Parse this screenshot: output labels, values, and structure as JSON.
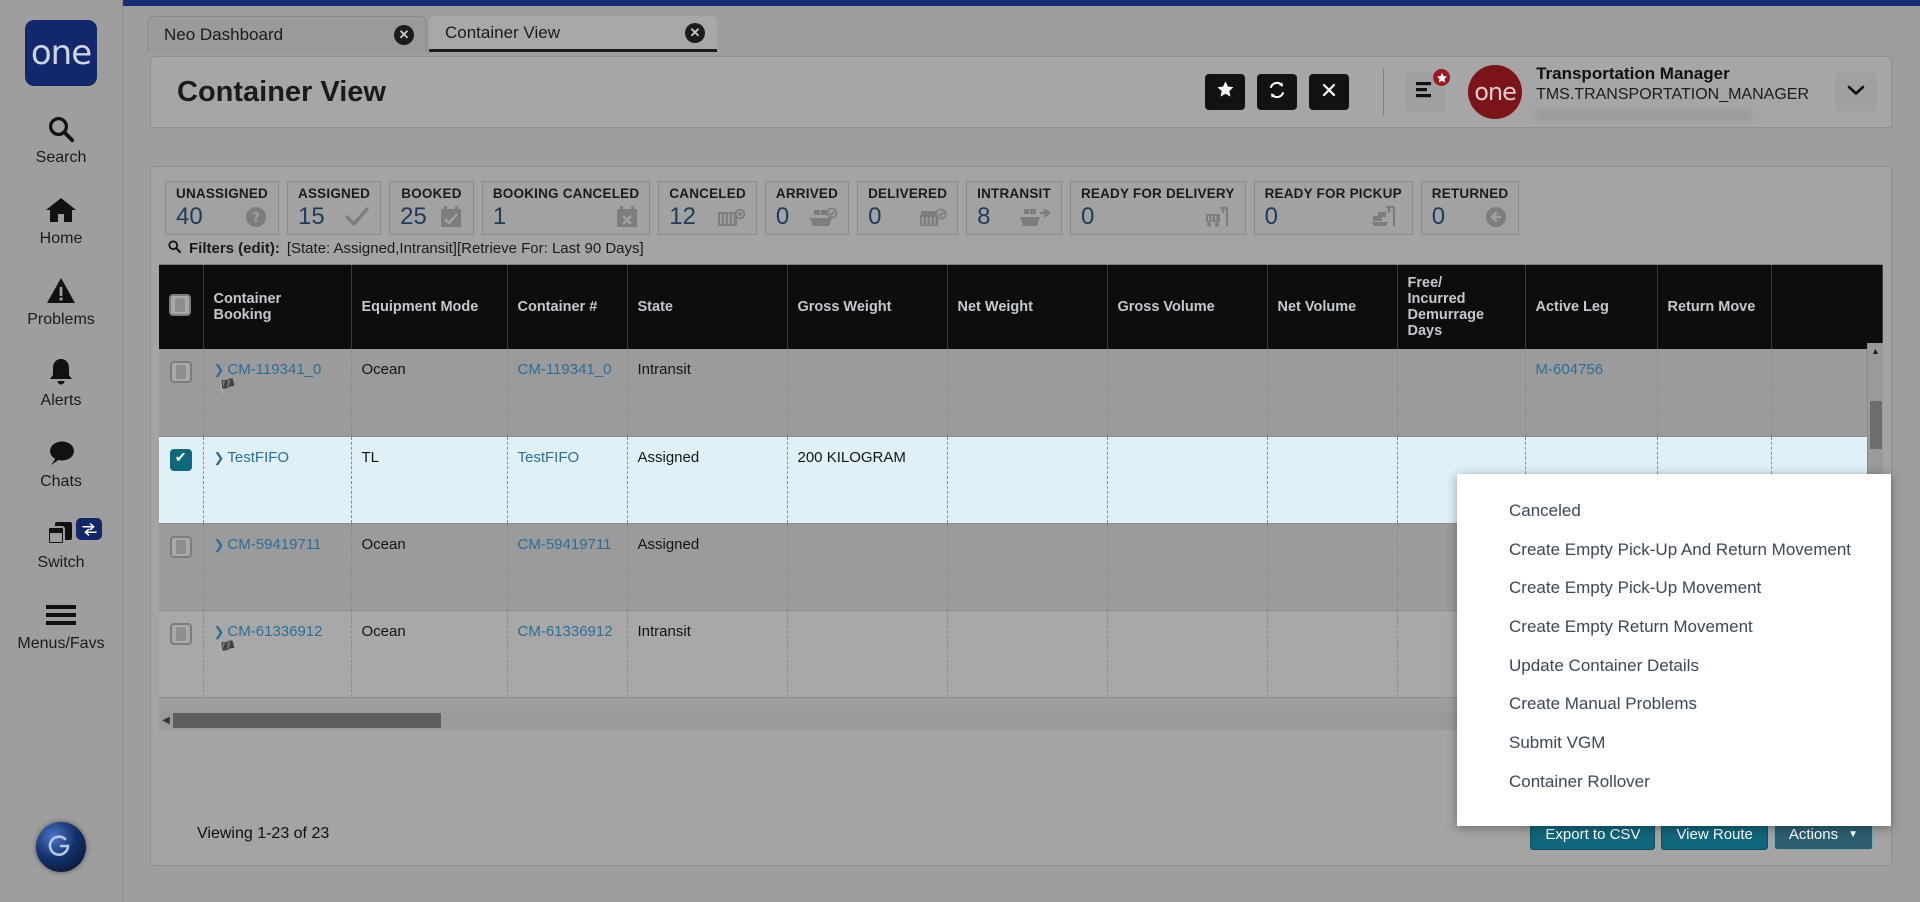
{
  "rail": {
    "brand": "one",
    "items": [
      {
        "label": "Search",
        "icon": "search-icon"
      },
      {
        "label": "Home",
        "icon": "home-icon"
      },
      {
        "label": "Problems",
        "icon": "warning-icon"
      },
      {
        "label": "Alerts",
        "icon": "bell-icon"
      },
      {
        "label": "Chats",
        "icon": "chat-icon"
      },
      {
        "label": "Switch",
        "icon": "switch-icon"
      },
      {
        "label": "Menus/Favs",
        "icon": "hamburger-icon"
      }
    ]
  },
  "tabs": [
    {
      "label": "Neo Dashboard",
      "active": false,
      "close": "close-icon"
    },
    {
      "label": "Container View",
      "active": true,
      "close": "close-icon"
    }
  ],
  "header": {
    "title": "Container View",
    "actions": [
      {
        "name": "favorite-button",
        "icon": "star-icon"
      },
      {
        "name": "refresh-button",
        "icon": "refresh-icon"
      },
      {
        "name": "close-button",
        "icon": "x-icon"
      }
    ],
    "menu_icon": "list-menu-icon",
    "menu_badge_icon": "star-badge-icon",
    "avatar_text": "one",
    "user_name": "Transportation Manager",
    "user_id": "TMS.TRANSPORTATION_MANAGER",
    "caret_icon": "chevron-down-icon"
  },
  "tiles": [
    {
      "label": "UNASSIGNED",
      "value": "40",
      "icon": "question-circle-icon"
    },
    {
      "label": "ASSIGNED",
      "value": "15",
      "icon": "check-icon"
    },
    {
      "label": "BOOKED",
      "value": "25",
      "icon": "calendar-check-icon"
    },
    {
      "label": "BOOKING CANCELED",
      "value": "1",
      "icon": "calendar-x-icon"
    },
    {
      "label": "CANCELED",
      "value": "12",
      "icon": "container-x-icon"
    },
    {
      "label": "ARRIVED",
      "value": "0",
      "icon": "ship-arrived-icon"
    },
    {
      "label": "DELIVERED",
      "value": "0",
      "icon": "container-check-icon"
    },
    {
      "label": "INTRANSIT",
      "value": "8",
      "icon": "ship-transit-icon"
    },
    {
      "label": "READY FOR DELIVERY",
      "value": "0",
      "icon": "truck-crane-icon"
    },
    {
      "label": "READY FOR PICKUP",
      "value": "0",
      "icon": "crane-pickup-icon"
    },
    {
      "label": "RETURNED",
      "value": "0",
      "icon": "arrow-left-circle-icon"
    }
  ],
  "filters": {
    "icon": "search-icon",
    "label": "Filters (edit):",
    "values": "[State: Assigned,Intransit][Retrieve For: Last 90 Days]"
  },
  "table": {
    "columns": [
      "Container Booking",
      "Equipment Mode",
      "Container #",
      "State",
      "Gross Weight",
      "Net Weight",
      "Gross Volume",
      "Net Volume",
      "Free/\nIncurred\nDemurrage\nDays",
      "Active Leg",
      "Return Move"
    ],
    "columns_display": [
      "Container Booking",
      "Equipment Mode",
      "Container #",
      "State",
      "Gross Weight",
      "Net Weight",
      "Gross Volume",
      "Net Volume",
      "Free/ Incurred Demurrage Days",
      "Active Leg",
      "Return Move"
    ],
    "rows": [
      {
        "selected": false,
        "container_booking": "CM-119341_0",
        "has_flag": true,
        "equipment_mode": "Ocean",
        "container_no": "CM-119341_0",
        "state": "Intransit",
        "gross_weight": "",
        "net_weight": "",
        "gross_volume": "",
        "net_volume": "",
        "demurrage_days": "",
        "active_leg": "M-604756",
        "return_move": ""
      },
      {
        "selected": true,
        "container_booking": "TestFIFO",
        "has_flag": false,
        "equipment_mode": "TL",
        "container_no": "TestFIFO",
        "state": "Assigned",
        "gross_weight": "200 KILOGRAM",
        "net_weight": "",
        "gross_volume": "",
        "net_volume": "",
        "demurrage_days": "",
        "active_leg": "",
        "return_move": ""
      },
      {
        "selected": false,
        "container_booking": "CM-59419711",
        "has_flag": false,
        "equipment_mode": "Ocean",
        "container_no": "CM-59419711",
        "state": "Assigned",
        "gross_weight": "",
        "net_weight": "",
        "gross_volume": "",
        "net_volume": "",
        "demurrage_days": "",
        "active_leg": "",
        "return_move": ""
      },
      {
        "selected": false,
        "container_booking": "CM-61336912",
        "has_flag": true,
        "equipment_mode": "Ocean",
        "container_no": "CM-61336912",
        "state": "Intransit",
        "gross_weight": "",
        "net_weight": "",
        "gross_volume": "",
        "net_volume": "",
        "demurrage_days": "",
        "active_leg": "",
        "return_move": ""
      }
    ]
  },
  "footer": {
    "viewing": "Viewing 1-23 of 23",
    "export_label": "Export to CSV",
    "view_route_label": "View Route",
    "actions_label": "Actions",
    "actions_caret": "caret-down-icon"
  },
  "actions_menu": {
    "items": [
      "Canceled",
      "Create Empty Pick-Up And Return Movement",
      "Create Empty Pick-Up Movement",
      "Create Empty Return Movement",
      "Update Container Details",
      "Create Manual Problems",
      "Submit VGM",
      "Container Rollover"
    ]
  },
  "colors": {
    "brand_blue": "#13276b",
    "accent_teal": "#11667b",
    "selected_row": "#dff0f7",
    "link": "#2d6e96",
    "header_black": "#0d0d0d",
    "avatar_maroon": "#7a1418"
  }
}
